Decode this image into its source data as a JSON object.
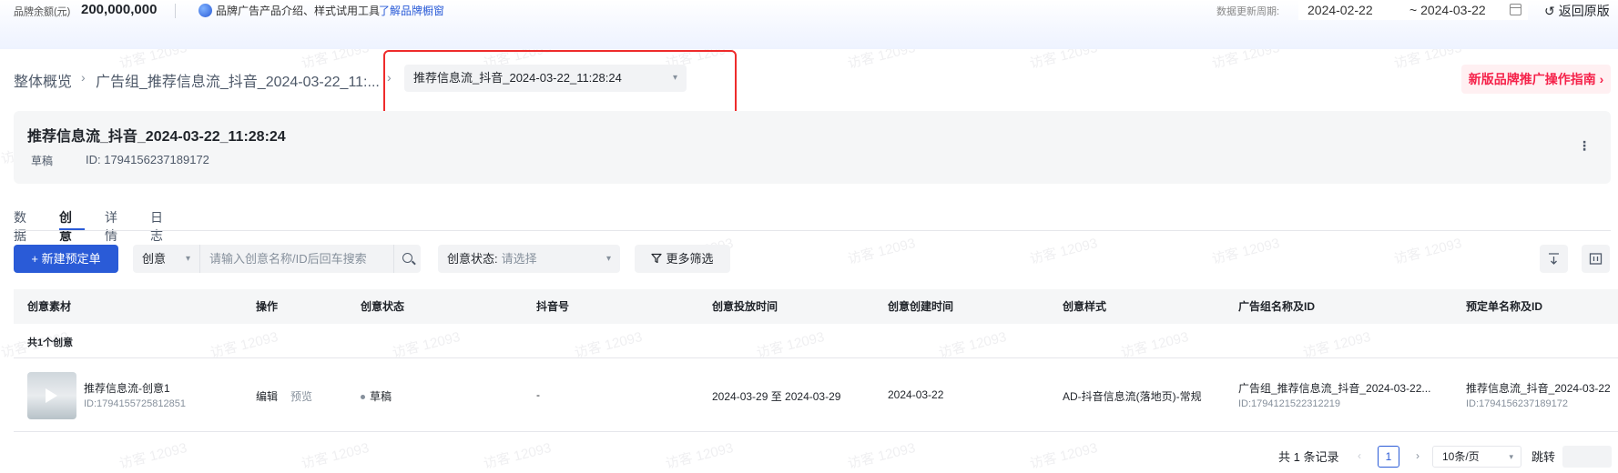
{
  "topbar": {
    "balance_label": "品牌余额(元)",
    "balance_value": "200,000,000",
    "promo_text": "品牌广告产品介绍、样式试用工具",
    "promo_link": "了解品牌橱窗",
    "period_label": "数据更新周期:",
    "date_start": "2024-02-22",
    "date_end": "~ 2024-03-22",
    "back_label": "返回原版"
  },
  "breadcrumb": {
    "items": [
      "整体概览",
      "广告组_推荐信息流_抖音_2024-03-22_11:..."
    ],
    "current_select": "推荐信息流_抖音_2024-03-22_11:28:24"
  },
  "guide_button": "新版品牌推广操作指南 ›",
  "info": {
    "title": "推荐信息流_抖音_2024-03-22_11:28:24",
    "status": "草稿",
    "id": "ID: 1794156237189172"
  },
  "tabs": [
    "数据",
    "创意",
    "详情",
    "日志"
  ],
  "toolbar": {
    "new_button": "+ 新建预定单",
    "search_type": "创意",
    "search_placeholder": "请输入创意名称/ID后回车搜索",
    "status_label": "创意状态:",
    "status_placeholder": "请选择",
    "more_filter": "更多筛选"
  },
  "table": {
    "headers": [
      "创意素材",
      "操作",
      "创意状态",
      "抖音号",
      "创意投放时间",
      "创意创建时间",
      "创意样式",
      "广告组名称及ID",
      "预定单名称及ID"
    ],
    "group_label": "共1个创意",
    "rows": [
      {
        "name": "推荐信息流-创意1",
        "id": "ID:1794155725812851",
        "action_edit": "编辑",
        "action_preview": "预览",
        "status": "草稿",
        "douyin": "-",
        "delivery_time": "2024-03-29 至 2024-03-29",
        "created": "2024-03-22",
        "style": "AD-抖音信息流(落地页)-常规",
        "adgroup_name": "广告组_推荐信息流_抖音_2024-03-22...",
        "adgroup_id": "ID:1794121522312219",
        "order_name": "推荐信息流_抖音_2024-03-22",
        "order_id": "ID:1794156237189172"
      }
    ]
  },
  "pagination": {
    "total": "共 1 条记录",
    "current_page": "1",
    "page_size": "10条/页",
    "jump_label": "跳转"
  },
  "watermark": "访客 12093"
}
